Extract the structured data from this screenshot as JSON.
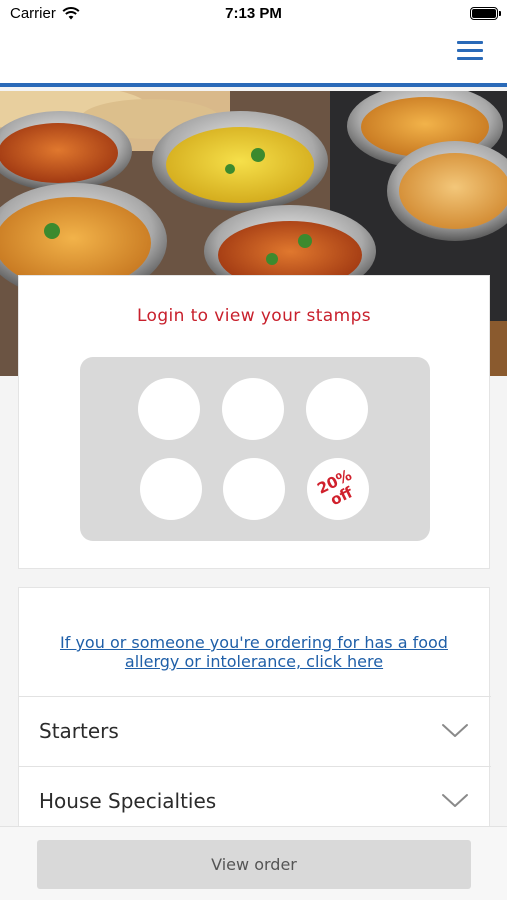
{
  "status_bar": {
    "carrier": "Carrier",
    "time": "7:13 PM",
    "wifi_icon": "wifi-icon",
    "battery_icon": "battery-icon"
  },
  "nav": {
    "menu_icon": "hamburger-menu-icon",
    "accent_color": "#2a6ab8"
  },
  "hero": {
    "image": "banner photo of curry dishes in copper-handled bowls"
  },
  "stamp_card": {
    "title": "Login to view your stamps",
    "stamps_total": 6,
    "reward_line1": "20%",
    "reward_line2": "off",
    "title_color": "#c8202c"
  },
  "menu": {
    "allergy_link": "If you or someone you're ordering for has a food allergy or intolerance, click here",
    "sections": [
      {
        "label": "Starters",
        "icon": "chevron-down-icon"
      },
      {
        "label": "House Specialties",
        "icon": "chevron-down-icon"
      }
    ]
  },
  "bottom": {
    "view_order_label": "View order"
  }
}
